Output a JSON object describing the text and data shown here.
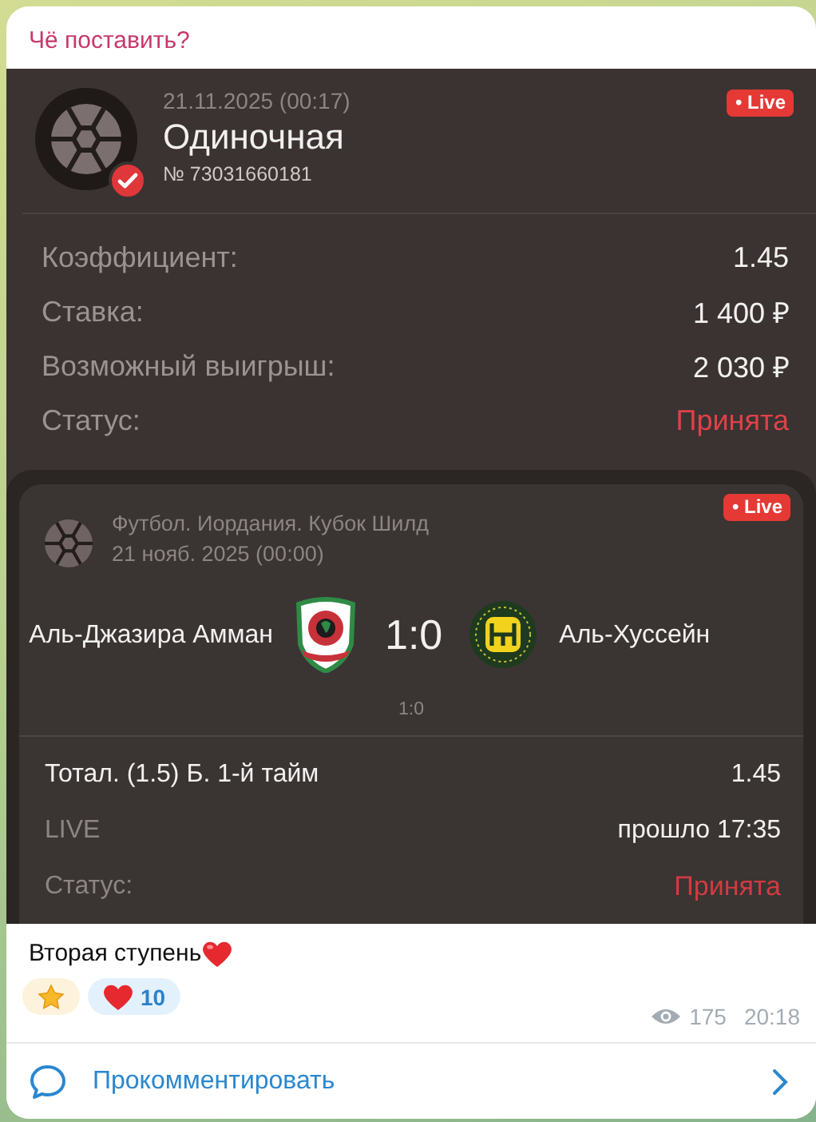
{
  "channel_name": "Чё поставить?",
  "bet": {
    "date": "21.11.2025 (00:17)",
    "type": "Одиночная",
    "number": "№ 73031660181",
    "live_badge": "• Live",
    "checked": true,
    "rows": [
      {
        "label": "Коэффициент:",
        "value": "1.45",
        "kind": "plain"
      },
      {
        "label": "Ставка:",
        "value": "1 400 ₽",
        "kind": "plain"
      },
      {
        "label": "Возможный выигрыш:",
        "value": "2 030 ₽",
        "kind": "plain"
      },
      {
        "label": "Статус:",
        "value": "Принята",
        "kind": "status"
      }
    ]
  },
  "event": {
    "league": "Футбол. Иордания. Кубок Шилд",
    "date": "21 нояб. 2025 (00:00)",
    "live_badge": "• Live",
    "home": "Аль-Джазира Амман",
    "score": "1:0",
    "away": "Аль-Хуссейн",
    "sub_score": "1:0",
    "rows": [
      {
        "label": "Тотал. (1.5) Б. 1-й тайм",
        "value": "1.45",
        "kind": "market"
      },
      {
        "label": "LIVE",
        "value": "прошло 17:35",
        "kind": "plain"
      },
      {
        "label": "Статус:",
        "value": "Принята",
        "kind": "status"
      }
    ]
  },
  "caption": "Вторая ступень",
  "reactions": [
    {
      "kind": "star"
    },
    {
      "kind": "heart",
      "count": "10"
    }
  ],
  "views": "175",
  "time": "20:18",
  "comment_button": "Прокомментировать"
}
